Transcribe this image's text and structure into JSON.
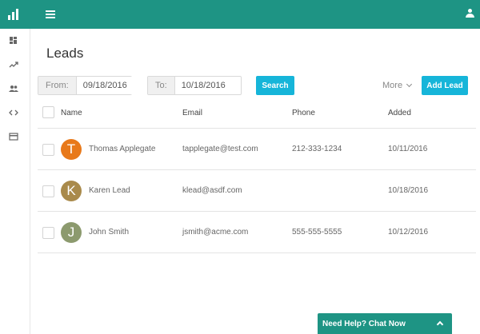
{
  "topbar": {
    "color": "#1e9484"
  },
  "sidebar": {
    "items": [
      {
        "icon": "dashboard-icon"
      },
      {
        "icon": "trending-icon"
      },
      {
        "icon": "people-icon"
      },
      {
        "icon": "code-icon"
      },
      {
        "icon": "card-icon"
      }
    ]
  },
  "page": {
    "title": "Leads"
  },
  "filters": {
    "from_label": "From:",
    "from_value": "09/18/2016",
    "to_label": "To:",
    "to_value": "10/18/2016",
    "search_label": "Search",
    "more_label": "More",
    "add_label": "Add Lead"
  },
  "table": {
    "headers": {
      "name": "Name",
      "email": "Email",
      "phone": "Phone",
      "added": "Added"
    },
    "rows": [
      {
        "initial": "T",
        "avatar_color": "#e8791a",
        "name": "Thomas Applegate",
        "email": "tapplegate@test.com",
        "phone": "212-333-1234",
        "added": "10/11/2016"
      },
      {
        "initial": "K",
        "avatar_color": "#a98a4b",
        "name": "Karen Lead",
        "email": "klead@asdf.com",
        "phone": "",
        "added": "10/18/2016"
      },
      {
        "initial": "J",
        "avatar_color": "#8c9a6e",
        "name": "John Smith",
        "email": "jsmith@acme.com",
        "phone": "555-555-5555",
        "added": "10/12/2016"
      }
    ]
  },
  "chat": {
    "label": "Need Help? Chat Now"
  }
}
